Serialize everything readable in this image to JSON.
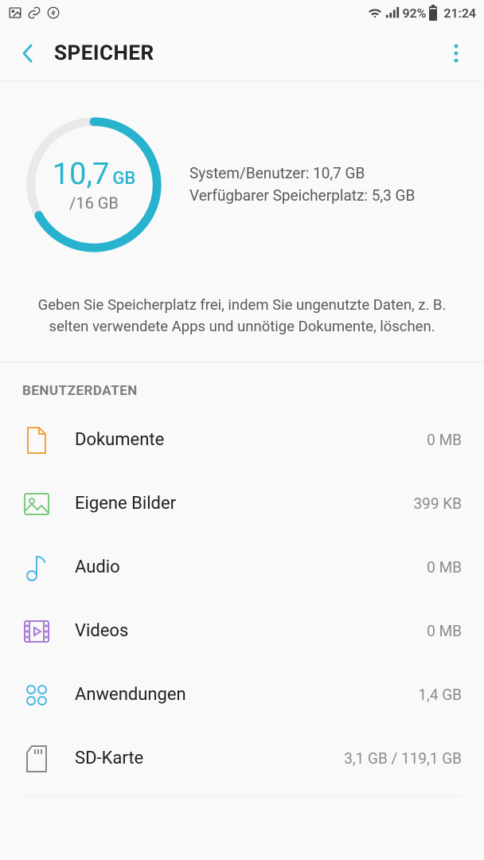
{
  "statusBar": {
    "battery_percent": "92%",
    "time": "21:24"
  },
  "header": {
    "title": "SPEICHER"
  },
  "usage": {
    "used_value": "10,7",
    "used_unit": "GB",
    "total_label": "/16 GB",
    "percent_used": 66.9,
    "line1": "System/Benutzer: 10,7 GB",
    "line2": "Verfügbarer Speicherplatz: 5,3 GB"
  },
  "help_text": "Geben Sie Speicherplatz frei, indem Sie ungenutzte Daten, z. B. selten verwendete Apps und unnötige Dokumente, löschen.",
  "section_header": "BENUTZERDATEN",
  "items": [
    {
      "label": "Dokumente",
      "value": "0 MB"
    },
    {
      "label": "Eigene Bilder",
      "value": "399 KB"
    },
    {
      "label": "Audio",
      "value": "0 MB"
    },
    {
      "label": "Videos",
      "value": "0 MB"
    },
    {
      "label": "Anwendungen",
      "value": "1,4 GB"
    },
    {
      "label": "SD-Karte",
      "value": "3,1 GB / 119,1 GB"
    }
  ]
}
